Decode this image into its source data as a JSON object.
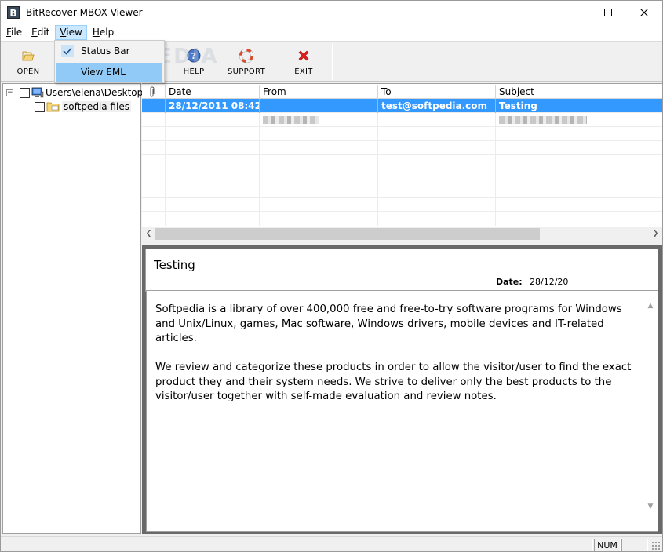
{
  "window": {
    "title": "BitRecover MBOX Viewer",
    "app_icon_letter": "B"
  },
  "menubar": {
    "items": [
      {
        "label": "File",
        "accel": "F"
      },
      {
        "label": "Edit",
        "accel": "E"
      },
      {
        "label": "View",
        "accel": "V"
      },
      {
        "label": "Help",
        "accel": "H"
      }
    ]
  },
  "view_menu": {
    "status_bar": "Status Bar",
    "view_eml": "View EML"
  },
  "toolbar": {
    "open": "OPEN",
    "help": "HELP",
    "support": "SUPPORT",
    "exit": "EXIT"
  },
  "watermark": "SOFTPEDIA",
  "tree": {
    "root": "Users\\elena\\Desktop",
    "child": "softpedia files"
  },
  "grid": {
    "columns": {
      "date": "Date",
      "from": "From",
      "to": "To",
      "subject": "Subject"
    },
    "rows": [
      {
        "date": "28/12/2011 08:42",
        "from": "",
        "to": "test@softpedia.com",
        "subject": "Testing"
      }
    ]
  },
  "preview": {
    "subject": "Testing",
    "date_label": "Date:",
    "date_value": "28/12/20",
    "paragraph1": "Softpedia is a library of over 400,000 free and free-to-try software programs for Windows and Unix/Linux, games, Mac software, Windows drivers, mobile devices and IT-related articles.",
    "paragraph2": "We review and categorize these products in order to allow the visitor/user to find the exact product they and their system needs. We strive to deliver only the best products to the visitor/user together with self-made evaluation and review notes."
  },
  "statusbar": {
    "num": "NUM"
  },
  "colors": {
    "selection": "#3399ff",
    "menu_highlight": "#91c9f7",
    "preview_bg": "#696969"
  }
}
